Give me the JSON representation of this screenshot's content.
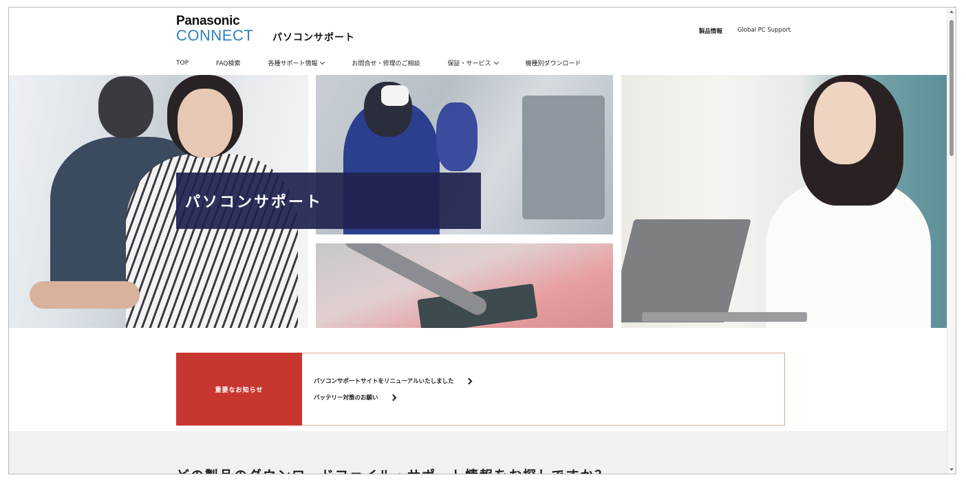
{
  "header": {
    "brand": "Panasonic",
    "brand_sub": "CONNECT",
    "site_title": "パソコンサポート",
    "util_links": [
      {
        "label": "製品情報"
      },
      {
        "label": "Global PC Support"
      }
    ],
    "nav": [
      {
        "label": "TOP",
        "dropdown": false
      },
      {
        "label": "FAQ検索",
        "dropdown": false
      },
      {
        "label": "各種サポート情報",
        "dropdown": true
      },
      {
        "label": "お問合せ・修理のご相談",
        "dropdown": false
      },
      {
        "label": "保証・サービス",
        "dropdown": true
      },
      {
        "label": "機種別ダウンロード",
        "dropdown": false
      }
    ]
  },
  "hero": {
    "title": "パソコンサポート"
  },
  "notice": {
    "label": "重要なお知らせ",
    "items": [
      {
        "text": "パソコンサポートサイトをリニューアルいたしました"
      },
      {
        "text": "バッテリー対策のお願い"
      }
    ]
  },
  "lower": {
    "heading": "どの製品のダウンロードファイル・サポート情報をお探しですか？"
  },
  "colors": {
    "brand_blue": "#2f7ec2",
    "notice_red": "#c8372f",
    "hero_title_bg": "#1e224e"
  }
}
